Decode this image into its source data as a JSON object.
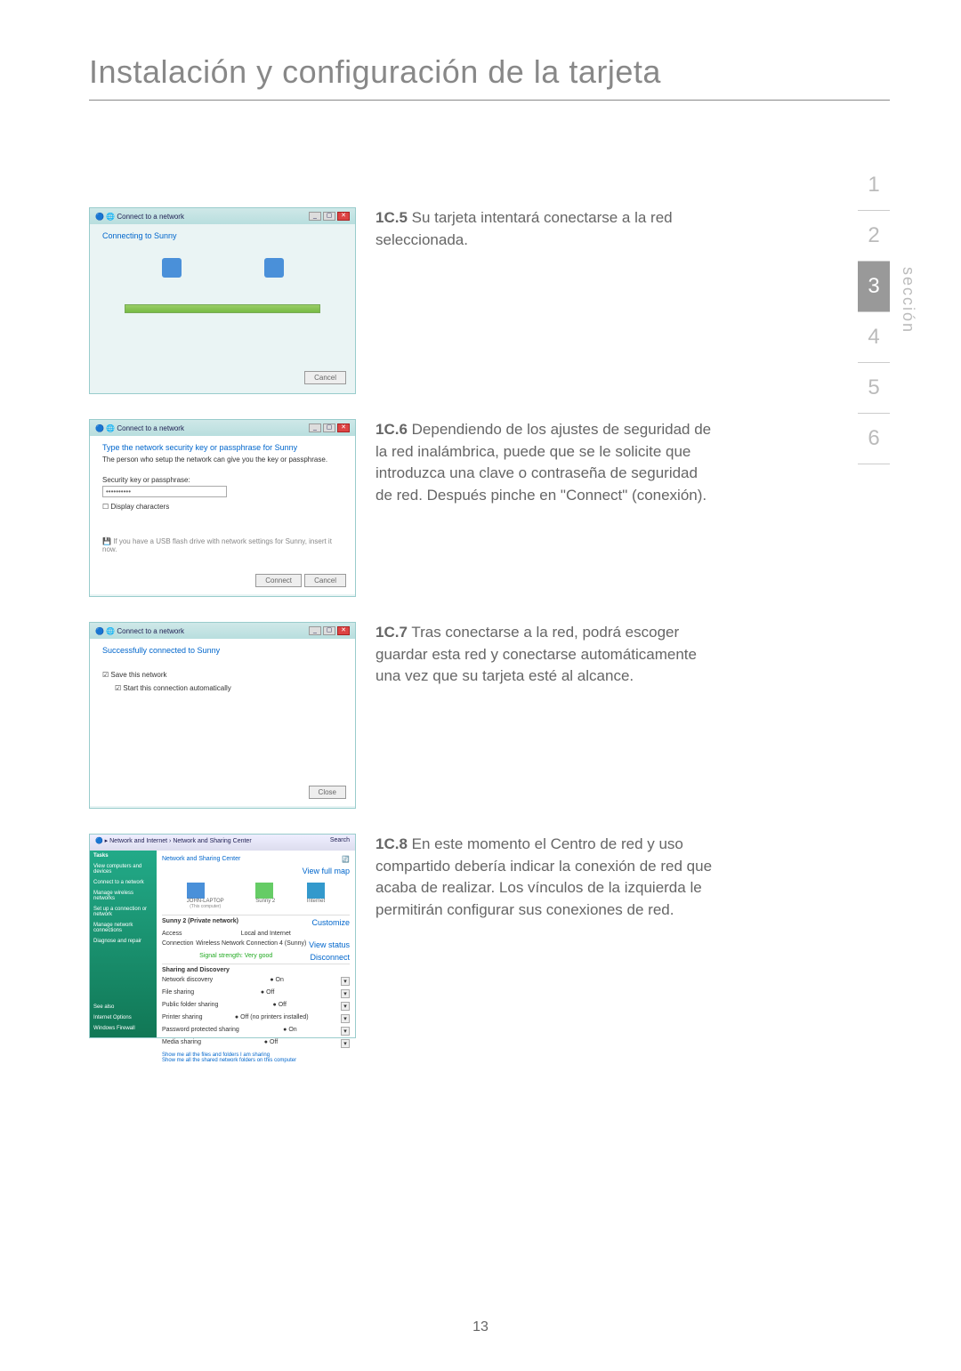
{
  "page_title": "Instalación y configuración de la tarjeta",
  "page_number": "13",
  "section_nav": {
    "label": "sección",
    "items": [
      "1",
      "2",
      "3",
      "4",
      "5",
      "6"
    ],
    "active_index": 2
  },
  "steps": [
    {
      "num": "1C.5",
      "text": "Su tarjeta intentará conectarse a la red seleccionada.",
      "screenshot": {
        "title": "Connect to a network",
        "line1": "Connecting to Sunny",
        "btn_cancel": "Cancel"
      }
    },
    {
      "num": "1C.6",
      "text": "Dependiendo de los ajustes de seguridad de la red inalámbrica, puede que se le solicite que introduzca una clave o contraseña de seguridad de red. Después pinche en \"Connect\" (conexión).",
      "screenshot": {
        "title": "Connect to a network",
        "prompt": "Type the network security key or passphrase for Sunny",
        "hint": "The person who setup the network can give you the key or passphrase.",
        "field_label": "Security key or passphrase:",
        "field_value": "••••••••••",
        "display_chars": "Display characters",
        "usb_hint": "If you have a USB flash drive with network settings for Sunny, insert it now.",
        "btn_connect": "Connect",
        "btn_cancel": "Cancel"
      }
    },
    {
      "num": "1C.7",
      "text": "Tras conectarse a la red, podrá escoger guardar esta red y conectarse automáticamente una vez que su tarjeta esté al alcance.",
      "screenshot": {
        "title": "Connect to a network",
        "success": "Successfully connected to Sunny",
        "save_network": "Save this network",
        "auto_connect": "Start this connection automatically",
        "btn_close": "Close"
      }
    },
    {
      "num": "1C.8",
      "text": "En este momento el Centro de red y uso compartido debería indicar la conexión de red que acaba de realizar. Los vínculos de la izquierda le permitirán configurar sus conexiones de red.",
      "screenshot": {
        "breadcrumb": "Network and Internet › Network and Sharing Center",
        "search": "Search",
        "side_tasks": "Tasks",
        "side_items": [
          "View computers and devices",
          "Connect to a network",
          "Manage wireless networks",
          "Set up a connection or network",
          "Manage network connections",
          "Diagnose and repair"
        ],
        "main_title": "Network and Sharing Center",
        "view_full": "View full map",
        "node_pc": "JOHN-LAPTOP",
        "node_pc_sub": "(This computer)",
        "node_net": "Sunny 2",
        "node_inet": "Internet",
        "group_net": "Sunny 2 (Private network)",
        "customize": "Customize",
        "row_access": "Access",
        "row_access_val": "Local and Internet",
        "row_conn": "Connection",
        "row_conn_val": "Wireless Network Connection 4 (Sunny)",
        "view_status": "View status",
        "signal": "Signal strength: Very good",
        "disconnect": "Disconnect",
        "group_sharing": "Sharing and Discovery",
        "rows": [
          {
            "k": "Network discovery",
            "v": "On"
          },
          {
            "k": "File sharing",
            "v": "Off"
          },
          {
            "k": "Public folder sharing",
            "v": "Off"
          },
          {
            "k": "Printer sharing",
            "v": "Off (no printers installed)"
          },
          {
            "k": "Password protected sharing",
            "v": "On"
          },
          {
            "k": "Media sharing",
            "v": "Off"
          }
        ],
        "footer1": "Show me all the files and folders I am sharing",
        "footer2": "Show me all the shared network folders on this computer",
        "side_bottom": [
          "See also",
          "Internet Options",
          "Windows Firewall"
        ]
      }
    }
  ]
}
